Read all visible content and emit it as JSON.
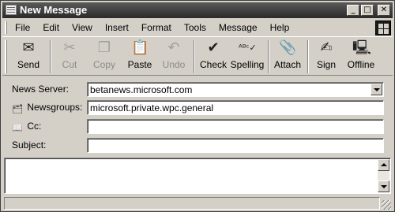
{
  "window": {
    "title": "New Message",
    "controls": {
      "minimize": "_",
      "maximize": "□",
      "close": "✕"
    }
  },
  "menu": {
    "items": [
      {
        "label": "File"
      },
      {
        "label": "Edit"
      },
      {
        "label": "View"
      },
      {
        "label": "Insert"
      },
      {
        "label": "Format"
      },
      {
        "label": "Tools"
      },
      {
        "label": "Message"
      },
      {
        "label": "Help"
      }
    ]
  },
  "toolbar": {
    "buttons": [
      {
        "label": "Send",
        "icon": "send-icon",
        "enabled": true
      },
      {
        "label": "Cut",
        "icon": "cut-icon",
        "enabled": false
      },
      {
        "label": "Copy",
        "icon": "copy-icon",
        "enabled": false
      },
      {
        "label": "Paste",
        "icon": "paste-icon",
        "enabled": true
      },
      {
        "label": "Undo",
        "icon": "undo-icon",
        "enabled": false
      },
      {
        "label": "Check",
        "icon": "check-names-icon",
        "enabled": true
      },
      {
        "label": "Spelling",
        "icon": "spelling-icon",
        "enabled": true
      },
      {
        "label": "Attach",
        "icon": "paperclip-icon",
        "enabled": true
      },
      {
        "label": "Sign",
        "icon": "sign-icon",
        "enabled": true
      },
      {
        "label": "Offline",
        "icon": "offline-icon",
        "enabled": true
      }
    ]
  },
  "fields": {
    "news_server": {
      "label": "News Server:",
      "value": "betanews.microsoft.com"
    },
    "newsgroups": {
      "label": "Newsgroups:",
      "value": "microsoft.private.wpc.general"
    },
    "cc": {
      "label": "Cc:",
      "value": ""
    },
    "subject": {
      "label": "Subject:",
      "value": ""
    }
  },
  "body": {
    "text": ""
  },
  "status": {
    "text": ""
  }
}
